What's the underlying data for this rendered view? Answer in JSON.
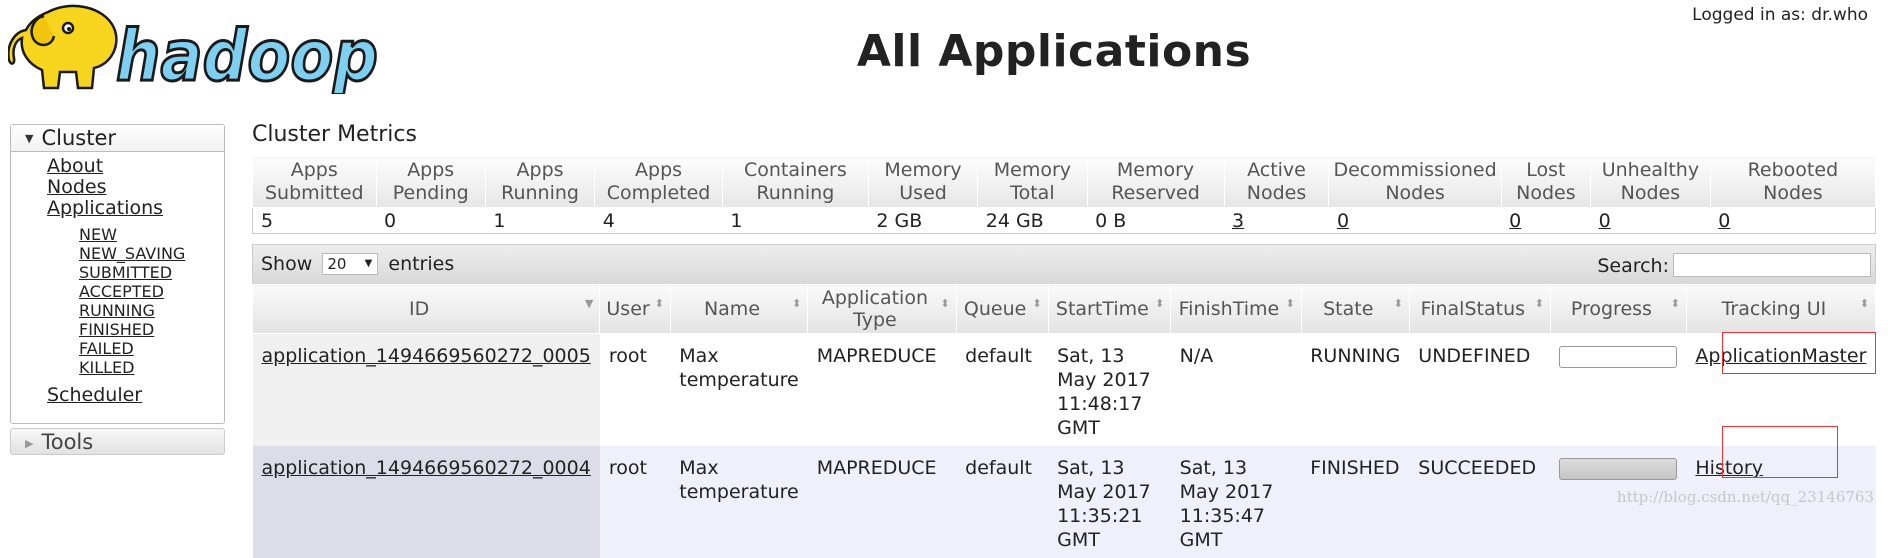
{
  "header": {
    "logo_text": "hadoop",
    "title": "All Applications",
    "user_info": "Logged in as: dr.who"
  },
  "nav": {
    "cluster_label": "Cluster",
    "items": [
      {
        "label": "About"
      },
      {
        "label": "Nodes"
      },
      {
        "label": "Applications"
      }
    ],
    "app_states": [
      "NEW",
      "NEW_SAVING",
      "SUBMITTED",
      "ACCEPTED",
      "RUNNING",
      "FINISHED",
      "FAILED",
      "KILLED"
    ],
    "scheduler_label": "Scheduler",
    "tools_label": "Tools"
  },
  "metrics": {
    "title": "Cluster Metrics",
    "headers": [
      [
        "Apps",
        "Submitted"
      ],
      [
        "Apps",
        "Pending"
      ],
      [
        "Apps",
        "Running"
      ],
      [
        "Apps",
        "Completed"
      ],
      [
        "Containers",
        "Running"
      ],
      [
        "Memory",
        "Used"
      ],
      [
        "Memory",
        "Total"
      ],
      [
        "Memory",
        "Reserved"
      ],
      [
        "Active",
        "Nodes"
      ],
      [
        "Decommissioned",
        "Nodes"
      ],
      [
        "Lost",
        "Nodes"
      ],
      [
        "Unhealthy",
        "Nodes"
      ],
      [
        "Rebooted",
        "Nodes"
      ]
    ],
    "values": [
      "5",
      "0",
      "1",
      "4",
      "1",
      "2 GB",
      "24 GB",
      "0 B",
      "3",
      "0",
      "0",
      "0",
      "0"
    ]
  },
  "table_controls": {
    "show_label": "Show",
    "length_value": "20",
    "entries_label": "entries",
    "search_label": "Search:"
  },
  "apps": {
    "columns": [
      [
        "ID"
      ],
      [
        "User"
      ],
      [
        "Name"
      ],
      [
        "Application Type"
      ],
      [
        "Queue"
      ],
      [
        "StartTime"
      ],
      [
        "FinishTime"
      ],
      [
        "State"
      ],
      [
        "FinalStatus"
      ],
      [
        "Progress"
      ],
      [
        "Tracking UI"
      ]
    ],
    "rows": [
      {
        "id": "application_1494669560272_0005",
        "user": "root",
        "name": "Max temperature",
        "type": "MAPREDUCE",
        "queue": "default",
        "start": "Sat, 13 May 2017 11:48:17 GMT",
        "finish": "N/A",
        "state": "RUNNING",
        "final_status": "UNDEFINED",
        "progress": 0,
        "tracking": "ApplicationMaster"
      },
      {
        "id": "application_1494669560272_0004",
        "user": "root",
        "name": "Max temperature",
        "type": "MAPREDUCE",
        "queue": "default",
        "start": "Sat, 13 May 2017 11:35:21 GMT",
        "finish": "Sat, 13 May 2017 11:35:47 GMT",
        "state": "FINISHED",
        "final_status": "SUCCEEDED",
        "progress": 100,
        "tracking": "History"
      }
    ]
  },
  "watermark": "http://blog.csdn.net/qq_23146763",
  "colors": {
    "elephant": "#f7d51e",
    "logo_text_fill": "#7fd0f0",
    "logo_outline": "#1a1a1a",
    "highlight_box": "#ee3333",
    "row_alt": "#eef0fa"
  }
}
